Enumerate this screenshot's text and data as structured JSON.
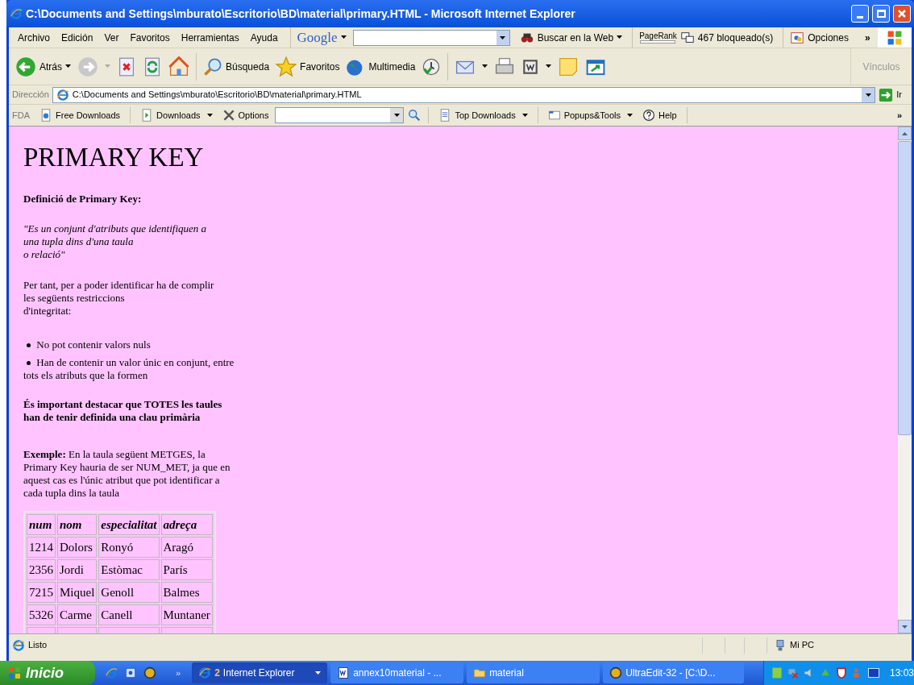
{
  "window": {
    "title": "C:\\Documents and Settings\\mburato\\Escritorio\\BD\\material\\primary.HTML - Microsoft Internet Explorer"
  },
  "menu": [
    "Archivo",
    "Edición",
    "Ver",
    "Favoritos",
    "Herramientas",
    "Ayuda"
  ],
  "google_bar": {
    "logo": "Google",
    "search_button": "Buscar en la Web",
    "pagerank": "PageRank",
    "blocked": "467 bloqueado(s)",
    "options": "Opciones",
    "overflow": "»"
  },
  "toolbar": {
    "back": "Atrás",
    "search": "Búsqueda",
    "favorites": "Favoritos",
    "media": "Multimedia",
    "links": "Vínculos"
  },
  "address": {
    "label": "Dirección",
    "value": "C:\\Documents and Settings\\mburato\\Escritorio\\BD\\material\\primary.HTML",
    "go": "Ir"
  },
  "fda_bar": {
    "label": "FDA",
    "items": [
      "Free Downloads",
      "Downloads",
      "Options",
      "Top Downloads",
      "Popups&Tools",
      "Help"
    ],
    "overflow": "»"
  },
  "page": {
    "title": "PRIMARY KEY",
    "definition_heading": "Definició de Primary Key:",
    "quote": "\"Es un conjunt d'atributs que identifiquen a\nuna tupla dins d'una taula\no relació\"",
    "paragraph": "Per tant, per a poder identificar ha de complir\nles següents restriccions\nd'integritat:",
    "bullets": [
      "No pot contenir valors nuls",
      "Han de contenir un valor únic en conjunt, entre tots els atributs que la formen"
    ],
    "note": "És important destacar que TOTES les taules han de tenir definida una clau primària",
    "example": "**Exemple:** En la taula següent METGES, la Primary Key hauria de ser NUM_MET, ja que en aquest cas es l'únic atribut que pot identificar a cada tupla dins la taula",
    "table": {
      "columns": [
        "num",
        "nom",
        "especialitat",
        "adreça"
      ],
      "rows": [
        [
          "1214",
          "Dolors",
          "Ronyó",
          "Aragó"
        ],
        [
          "2356",
          "Jordi",
          "Estòmac",
          "París"
        ],
        [
          "7215",
          "Miquel",
          "Genoll",
          "Balmes"
        ],
        [
          "5326",
          "Carme",
          "Canell",
          "Muntaner"
        ]
      ]
    }
  },
  "status_bar": {
    "text": "Listo",
    "zone": "Mi PC"
  },
  "taskbar": {
    "start": "Inicio",
    "overflow": "»",
    "buttons": [
      {
        "count": "2",
        "label": "Internet Explorer",
        "selected": true
      },
      {
        "label": "annex10material - ...",
        "selected": false
      },
      {
        "label": "material",
        "selected": false
      },
      {
        "label": "UltraEdit-32 - [C:\\D...",
        "selected": false
      }
    ],
    "clock": "13:03"
  }
}
